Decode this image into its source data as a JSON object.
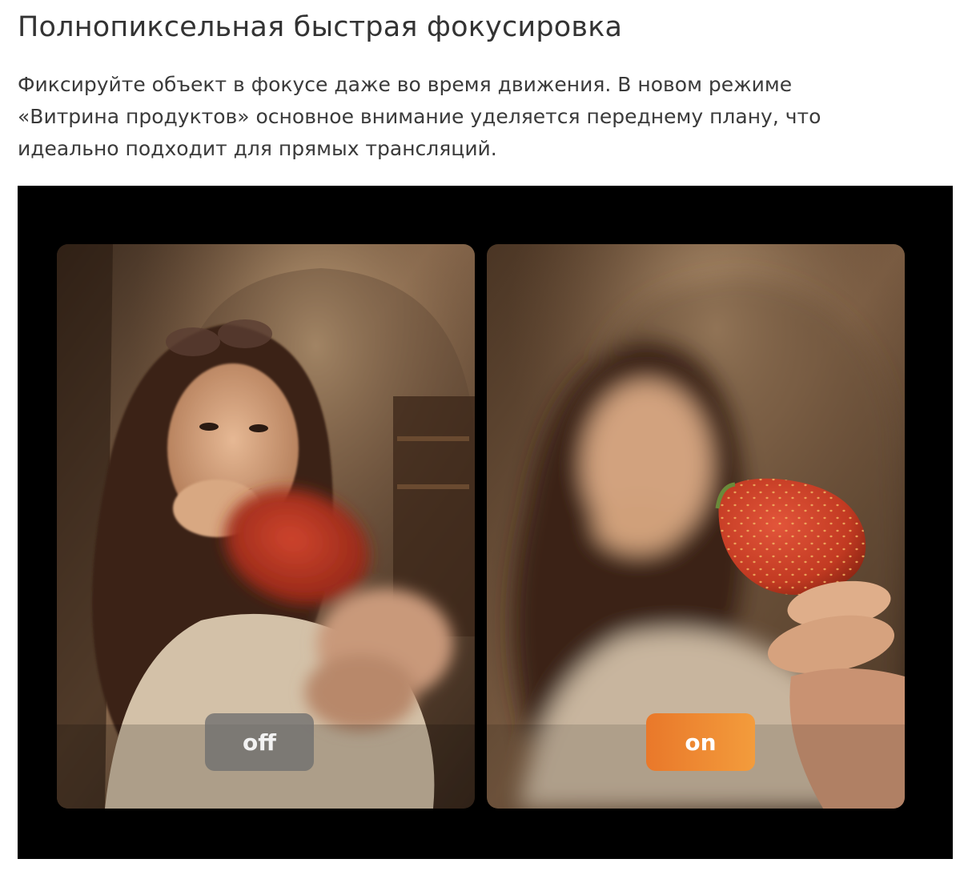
{
  "heading": "Полнопиксельная быстрая фокусировка",
  "description": {
    "lines": [
      "Фиксируйте объект в фокусе даже во время движения. В новом режиме",
      "«Витрина продуктов» основное внимание уделяется переднему плану, что",
      "идеально подходит для прямых трансляций."
    ]
  },
  "comparison": {
    "off_label": "off",
    "on_label": "on",
    "colors": {
      "frame_background": "#000000",
      "off_badge": "#6e6e6e",
      "on_badge_start": "#e9782a",
      "on_badge_end": "#f39c3c"
    }
  }
}
